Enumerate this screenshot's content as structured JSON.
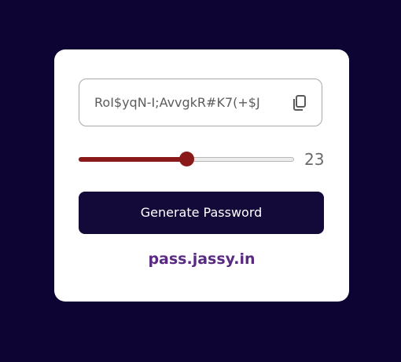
{
  "password": {
    "value": "RoI$yqN-I;AvvgkR#K7(+$J"
  },
  "copy_button": {
    "icon": "copy-icon"
  },
  "length_slider": {
    "min": 0,
    "max": 46,
    "value": 23,
    "value_label": "23"
  },
  "generate_button": {
    "label": "Generate Password"
  },
  "footer": {
    "link_text": "pass.jassy.in"
  },
  "colors": {
    "background": "#0d0433",
    "card": "#ffffff",
    "button": "#140a3a",
    "slider_accent": "#8a1a1a",
    "link": "#5a2a82"
  }
}
